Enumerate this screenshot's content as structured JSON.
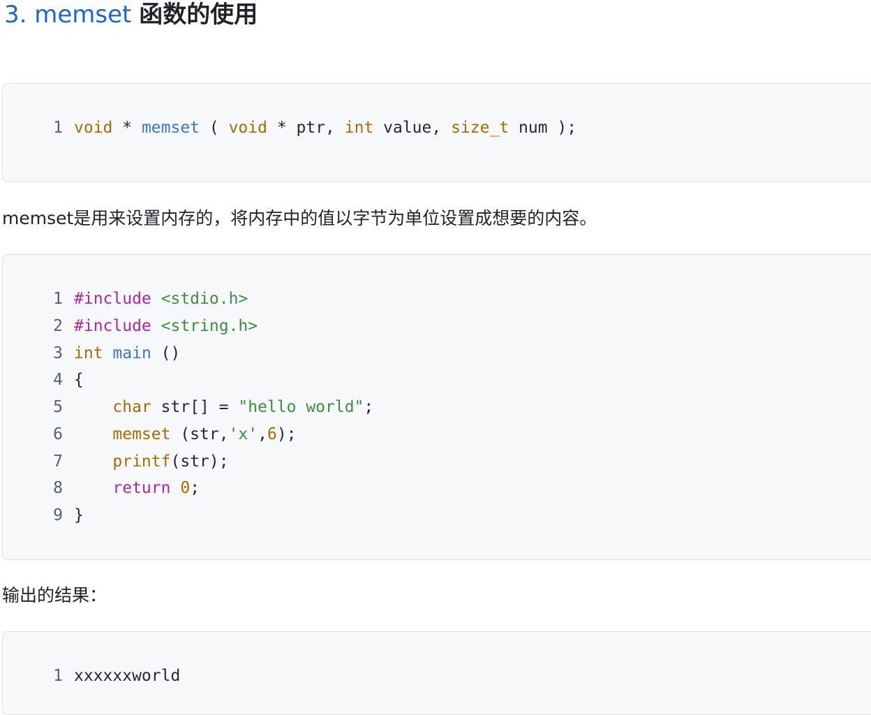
{
  "heading": {
    "number": "3.",
    "function_name": "memset",
    "rest": "函数的使用"
  },
  "code1": {
    "lines": [
      {
        "n": "1",
        "tokens": [
          {
            "t": "void",
            "c": "kw"
          },
          {
            "t": " * "
          },
          {
            "t": "memset",
            "c": "fnc"
          },
          {
            "t": " ( "
          },
          {
            "t": "void",
            "c": "kw"
          },
          {
            "t": " * ptr, "
          },
          {
            "t": "int",
            "c": "kw"
          },
          {
            "t": " value, "
          },
          {
            "t": "size_t",
            "c": "kw"
          },
          {
            "t": " num );"
          }
        ]
      }
    ]
  },
  "paragraph1": "memset是用来设置内存的，将内存中的值以字节为单位设置成想要的内容。",
  "code2": {
    "lines": [
      {
        "n": "1",
        "tokens": [
          {
            "t": "#include",
            "c": "pp"
          },
          {
            "t": " "
          },
          {
            "t": "<stdio.h>",
            "c": "str"
          }
        ]
      },
      {
        "n": "2",
        "tokens": [
          {
            "t": "#include",
            "c": "pp"
          },
          {
            "t": " "
          },
          {
            "t": "<string.h>",
            "c": "str"
          }
        ]
      },
      {
        "n": "3",
        "tokens": [
          {
            "t": "int",
            "c": "kw"
          },
          {
            "t": " "
          },
          {
            "t": "main",
            "c": "fnc"
          },
          {
            "t": " ()"
          }
        ]
      },
      {
        "n": "4",
        "tokens": [
          {
            "t": "{"
          }
        ]
      },
      {
        "n": "5",
        "tokens": [
          {
            "t": "    "
          },
          {
            "t": "char",
            "c": "kw"
          },
          {
            "t": " str[] = "
          },
          {
            "t": "\"hello world\"",
            "c": "str"
          },
          {
            "t": ";"
          }
        ]
      },
      {
        "n": "6",
        "tokens": [
          {
            "t": "    "
          },
          {
            "t": "memset",
            "c": "call"
          },
          {
            "t": " (str,"
          },
          {
            "t": "'x'",
            "c": "str"
          },
          {
            "t": ","
          },
          {
            "t": "6",
            "c": "numc"
          },
          {
            "t": ");"
          }
        ]
      },
      {
        "n": "7",
        "tokens": [
          {
            "t": "    "
          },
          {
            "t": "printf",
            "c": "call"
          },
          {
            "t": "(str);"
          }
        ]
      },
      {
        "n": "8",
        "tokens": [
          {
            "t": "    "
          },
          {
            "t": "return",
            "c": "pp"
          },
          {
            "t": " "
          },
          {
            "t": "0",
            "c": "numc"
          },
          {
            "t": ";"
          }
        ]
      },
      {
        "n": "9",
        "tokens": [
          {
            "t": "}"
          }
        ]
      }
    ]
  },
  "paragraph2": "输出的结果：",
  "code3": {
    "lines": [
      {
        "n": "1",
        "tokens": [
          {
            "t": "xxxxxxworld"
          }
        ]
      }
    ]
  }
}
